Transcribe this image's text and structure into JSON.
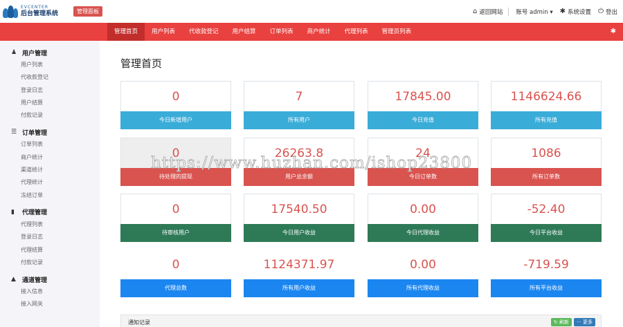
{
  "header": {
    "logo_sub": "EVCENTER",
    "logo_main": "后台管理系统",
    "badge": "管理面板",
    "links": [
      {
        "icon": "home-icon",
        "glyph": "⌂",
        "label": "返回网站"
      },
      {
        "icon": "user-icon",
        "glyph": "",
        "label": "账号 admin ▾"
      },
      {
        "icon": "gear-icon",
        "glyph": "✱",
        "label": "系统设置"
      },
      {
        "icon": "power-icon",
        "glyph": "⏻",
        "label": "登出"
      }
    ]
  },
  "nav": {
    "items": [
      "管理首页",
      "用户列表",
      "代收款登记",
      "用户结算",
      "订单列表",
      "商户统计",
      "代理列表",
      "管理员列表"
    ],
    "active": "管理首页"
  },
  "sidebar": {
    "groups": [
      {
        "title": "用户管理",
        "icon": "user-icon",
        "glyph": "♟",
        "items": [
          "用户列表",
          "代收款登记",
          "登录日志",
          "用户结算",
          "付款记录"
        ]
      },
      {
        "title": "订单管理",
        "icon": "list-icon",
        "glyph": "☰",
        "items": [
          "订单列表",
          "商户统计",
          "渠道统计",
          "代理统计",
          "冻结订单"
        ]
      },
      {
        "title": "代理管理",
        "icon": "file-icon",
        "glyph": "▮",
        "items": [
          "代理列表",
          "登录日志",
          "代理结算",
          "付款记录"
        ]
      },
      {
        "title": "通道管理",
        "icon": "road-icon",
        "glyph": "▲",
        "items": [
          "接入信息",
          "接入网关"
        ]
      }
    ]
  },
  "main": {
    "title": "管理首页",
    "cards": [
      {
        "value": "0",
        "label": "今日新增用户",
        "color": "blue"
      },
      {
        "value": "7",
        "label": "所有用户",
        "color": "blue"
      },
      {
        "value": "17845.00",
        "label": "今日充值",
        "color": "blue"
      },
      {
        "value": "1146624.66",
        "label": "所有充值",
        "color": "blue"
      },
      {
        "value": "0",
        "label": "待处理的提现",
        "color": "red"
      },
      {
        "value": "26263.8",
        "label": "用户总余额",
        "color": "red"
      },
      {
        "value": "24",
        "label": "今日订单数",
        "color": "red"
      },
      {
        "value": "1086",
        "label": "所有订单数",
        "color": "red"
      },
      {
        "value": "0",
        "label": "待审核用户",
        "color": "green"
      },
      {
        "value": "17540.50",
        "label": "今日用户收益",
        "color": "green"
      },
      {
        "value": "0.00",
        "label": "今日代理收益",
        "color": "green"
      },
      {
        "value": "-52.40",
        "label": "今日平台收益",
        "color": "green"
      },
      {
        "value": "0",
        "label": "代理总数",
        "color": "brand"
      },
      {
        "value": "1124371.97",
        "label": "所有用户收益",
        "color": "brand"
      },
      {
        "value": "0.00",
        "label": "所有代理收益",
        "color": "brand"
      },
      {
        "value": "-719.59",
        "label": "所有平台收益",
        "color": "brand"
      }
    ],
    "notice": {
      "title": "通知记录",
      "refresh": "↻ 刷新",
      "more": "··· 更多"
    }
  },
  "watermark": "https://www.huzhan.com/ishop23800",
  "colors": {
    "nav_red": "#e9413f",
    "value_red": "#d9534f",
    "label_blue": "#3aacd8",
    "label_red": "#d9534f",
    "label_green": "#2e7a57",
    "label_brand": "#1b86f0"
  }
}
